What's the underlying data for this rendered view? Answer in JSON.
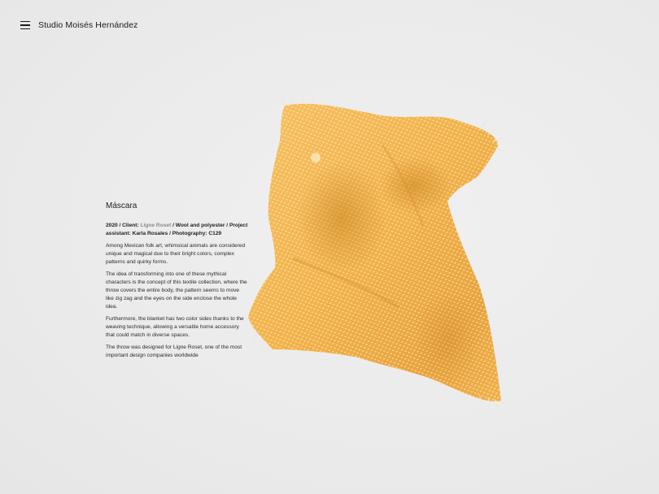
{
  "header": {
    "site_title": "Studio Moisés Hernández",
    "menu_icon": "hamburger-menu-icon"
  },
  "project": {
    "title": "Máscara",
    "meta": {
      "prefix": "2020 / Client: ",
      "client": "Ligne Roset",
      "suffix": " / Wool and polyester / Project assistant: Karla Rosales / Photography: C129"
    },
    "paragraphs": [
      "Among Mexican folk art, whimsical animals are considered unique and magical due to their bright colors, complex patterns and quirky forms.",
      "The idea of transforming into one of these mythical characters is the concept of this textile collection, where the throw covers the entire body, the pattern seems to move like zig zag and the eyes on the side enclose the whole idea.",
      "Furthermore, the blanket has two color sides thanks to the weaving technique, allowing a versatile home accessory that could match in diverse spaces.",
      "The throw was designed for Ligne Roset, one of the most important design companies worldwide"
    ]
  },
  "image": {
    "subject": "orange-woven-throw-blanket",
    "colors": {
      "base": "#f2b24a",
      "light": "#f7c46a",
      "shadow": "#d88f2a",
      "pattern": "#fbe6b8",
      "fringe": "#efe6d6",
      "background": "#ebebeb"
    }
  }
}
